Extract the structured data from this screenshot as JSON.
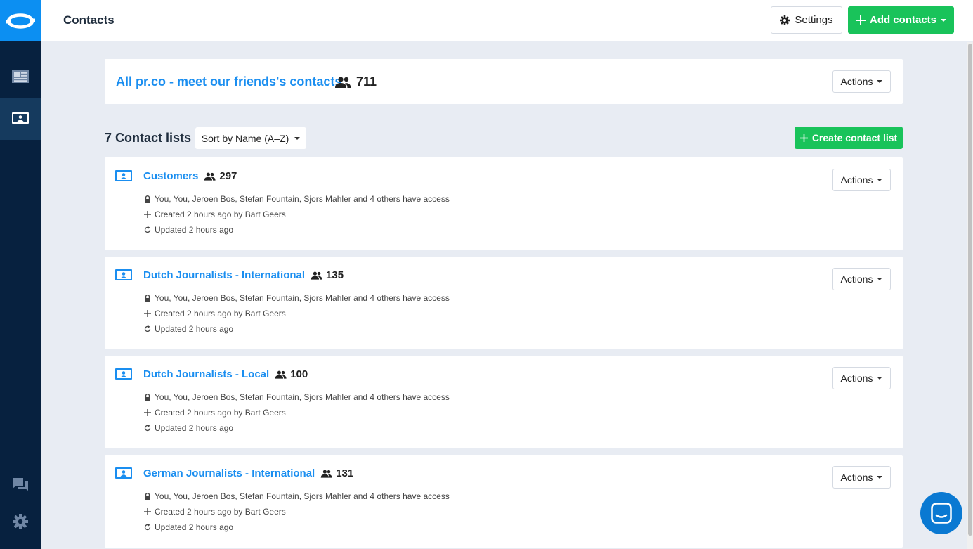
{
  "sidebar": {
    "logo": "prco-logo-icon",
    "items": [
      {
        "name": "newsroom",
        "icon": "newspaper-icon",
        "active": false
      },
      {
        "name": "contacts",
        "icon": "contact-card-icon",
        "active": true
      }
    ],
    "bottom": [
      {
        "name": "chat",
        "icon": "chat-icon"
      },
      {
        "name": "settings",
        "icon": "gear-icon"
      }
    ]
  },
  "header": {
    "title": "Contacts",
    "settings_label": "Settings",
    "add_label": "Add contacts"
  },
  "all_contacts": {
    "label": "All pr.co - meet our friends's contacts",
    "count": "711",
    "actions_label": "Actions"
  },
  "lists_header": {
    "heading": "7 Contact lists",
    "sort_label": "Sort by Name (A–Z)",
    "create_label": "Create contact list"
  },
  "lists": [
    {
      "name": "Customers",
      "count": "297",
      "access": "You, You, Jeroen Bos, Stefan Fountain, Sjors Mahler and 4 others have access",
      "created": "Created 2 hours ago by Bart Geers",
      "updated": "Updated 2 hours ago",
      "actions_label": "Actions"
    },
    {
      "name": "Dutch Journalists - International",
      "count": "135",
      "access": "You, You, Jeroen Bos, Stefan Fountain, Sjors Mahler and 4 others have access",
      "created": "Created 2 hours ago by Bart Geers",
      "updated": "Updated 2 hours ago",
      "actions_label": "Actions"
    },
    {
      "name": "Dutch Journalists - Local",
      "count": "100",
      "access": "You, You, Jeroen Bos, Stefan Fountain, Sjors Mahler and 4 others have access",
      "created": "Created 2 hours ago by Bart Geers",
      "updated": "Updated 2 hours ago",
      "actions_label": "Actions"
    },
    {
      "name": "German Journalists - International",
      "count": "131",
      "access": "You, You, Jeroen Bos, Stefan Fountain, Sjors Mahler and 4 others have access",
      "created": "Created 2 hours ago by Bart Geers",
      "updated": "Updated 2 hours ago",
      "actions_label": "Actions"
    }
  ],
  "chat_widget": {
    "icon": "intercom-chat-icon"
  },
  "colors": {
    "brand_blue": "#0c8ff2",
    "link_blue": "#1a8ef0",
    "sidebar_dark": "#07213f",
    "green": "#19c35a",
    "background": "#e8ecf3"
  }
}
